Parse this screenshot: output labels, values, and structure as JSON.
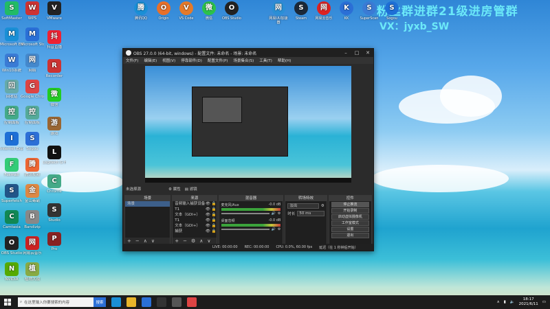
{
  "watermark": {
    "line1": "粉丝群进群21级进房管群",
    "line2": "VX：jyxb_SW"
  },
  "desktop_left_icons": [
    {
      "label": "SoftMaster",
      "icon": "app-icon",
      "color": "#2b6"
    },
    {
      "label": "Microsoft Edge",
      "icon": "edge-icon",
      "color": "#1a8fd6"
    },
    {
      "label": "Win10系统",
      "icon": "pc-icon",
      "color": "#3a7bd5"
    },
    {
      "label": "回收站",
      "icon": "recycle-bin-icon",
      "color": "#6aa"
    },
    {
      "label": "控制面板",
      "icon": "control-panel-icon",
      "color": "#4a8"
    },
    {
      "label": "Internet Explorer",
      "icon": "ie-icon",
      "color": "#1e6fd6"
    },
    {
      "label": "Foxmail",
      "icon": "mail-icon",
      "color": "#3c7"
    },
    {
      "label": "Superfetch",
      "icon": "app-icon",
      "color": "#258"
    },
    {
      "label": "Camtasia",
      "icon": "camtasia-icon",
      "color": "#185"
    },
    {
      "label": "OBS Studio",
      "icon": "obs-icon",
      "color": "#222"
    },
    {
      "label": "NVIDIA",
      "icon": "nvidia-icon",
      "color": "#5a0"
    }
  ],
  "desktop_col2_icons": [
    {
      "label": "WPS",
      "icon": "wps-icon",
      "color": "#c33"
    },
    {
      "label": "Microsoft Store",
      "icon": "store-icon",
      "color": "#2a6fd6"
    },
    {
      "label": "网络",
      "icon": "network-icon",
      "color": "#48c"
    },
    {
      "label": "Google Chrome",
      "icon": "chrome-icon",
      "color": "#d44"
    },
    {
      "label": "控制面板",
      "icon": "settings-icon",
      "color": "#5a9"
    },
    {
      "label": "Sogou",
      "icon": "sogou-icon",
      "color": "#2d6fd6"
    },
    {
      "label": "腾讯视频",
      "icon": "video-icon",
      "color": "#e63"
    },
    {
      "label": "金山毒霸",
      "icon": "shield-icon",
      "color": "#d84"
    },
    {
      "label": "Bandizip",
      "icon": "zip-icon",
      "color": "#888"
    },
    {
      "label": "网易云音乐",
      "icon": "music-icon",
      "color": "#c22"
    },
    {
      "label": "植物大战",
      "icon": "game-icon",
      "color": "#8a4"
    }
  ],
  "desktop_col3_icons": [
    {
      "label": "VMware",
      "icon": "vm-icon",
      "color": "#222"
    },
    {
      "label": "抖音直播",
      "icon": "douyin-icon",
      "color": "#e23"
    },
    {
      "label": "Recorder",
      "icon": "record-icon",
      "color": "#c33"
    },
    {
      "label": "微信",
      "icon": "wechat-icon",
      "color": "#2c2"
    },
    {
      "label": "游戏",
      "icon": "game-icon",
      "color": "#963"
    },
    {
      "label": "Logitech G HUB",
      "icon": "logitech-icon",
      "color": "#111"
    },
    {
      "label": "Chrome",
      "icon": "chrome-icon",
      "color": "#4a8"
    },
    {
      "label": "Studio",
      "icon": "studio-icon",
      "color": "#333"
    },
    {
      "label": "Pro",
      "icon": "app-icon",
      "color": "#822"
    }
  ],
  "desktop_top_icons": [
    {
      "label": "腾讯QQ",
      "icon": "qq-icon",
      "color": "#1a8fd6"
    },
    {
      "label": "Origin",
      "icon": "origin-icon",
      "color": "#e8702a"
    },
    {
      "label": "VS Code",
      "icon": "app-icon",
      "color": "#e57a2a"
    },
    {
      "label": "微信",
      "icon": "wechat-icon",
      "color": "#2cc24a"
    },
    {
      "label": "OBS Studio",
      "icon": "obs-icon",
      "color": "#222"
    },
    {
      "label": "网易UU加速器",
      "icon": "uu-icon",
      "color": "#2a8fd6"
    },
    {
      "label": "Steam",
      "icon": "steam-icon",
      "color": "#1b2838"
    },
    {
      "label": "网易云音乐",
      "icon": "music-icon",
      "color": "#d22"
    },
    {
      "label": "KK",
      "icon": "k-icon",
      "color": "#2b6fd6"
    },
    {
      "label": "SuperScan",
      "icon": "s-icon",
      "color": "#3a7bd5"
    },
    {
      "label": "Sogou",
      "icon": "s-icon",
      "color": "#1e6fd6"
    }
  ],
  "obs": {
    "title": "OBS 27.0.0 (64-bit, windows) - 配置文件: 未命名 - 场景: 未命名",
    "menu": [
      "文件(F)",
      "编辑(E)",
      "视图(V)",
      "停靠部件(D)",
      "配置文件(P)",
      "场景集合(S)",
      "工具(T)",
      "帮助(H)"
    ],
    "scene_bar": {
      "label": "未选择源",
      "props": "属性",
      "filters": "滤镜"
    },
    "scenes": {
      "header": "场景",
      "items": [
        "场景"
      ]
    },
    "sources": {
      "header": "来源",
      "items": [
        "音频输入捕获设备",
        "T1",
        "文本（GDI+）",
        "T1",
        "文本（GDI+）",
        "捕获"
      ]
    },
    "mixer": {
      "header": "混音器",
      "ch1": "麦克风/Aux",
      "ch1_db": "-0.0 dB",
      "ch2": "桌面音频",
      "ch2_db": "-0.0 dB"
    },
    "transitions": {
      "header": "转场特效",
      "type": "淡出",
      "duration_label": "时长",
      "duration": "50 ms"
    },
    "controls": {
      "header": "控件",
      "buttons": [
        "停止推流",
        "开始录制",
        "启动虚拟摄像机",
        "工作室模式",
        "设置",
        "退出"
      ]
    },
    "status": {
      "live": "LIVE: 00:00:00",
      "rec": "REC: 00:00:00",
      "cpu": "CPU: 0.0%, 60.00 fps",
      "delay": "延迟（在 1 秒钟后开始）"
    }
  },
  "taskbar": {
    "search_placeholder": "在这里输入你要搜索的内容",
    "search_button": "搜索",
    "time": "18:17",
    "date": "2021/6/11",
    "apps": [
      {
        "icon": "edge-icon",
        "color": "#1a8fd6"
      },
      {
        "icon": "folder-icon",
        "color": "#e8b42a"
      },
      {
        "icon": "store-icon",
        "color": "#2a6fd6"
      },
      {
        "icon": "obs-icon",
        "color": "#333"
      },
      {
        "icon": "app-icon",
        "color": "#555"
      },
      {
        "icon": "chrome-icon",
        "color": "#d44"
      }
    ]
  }
}
